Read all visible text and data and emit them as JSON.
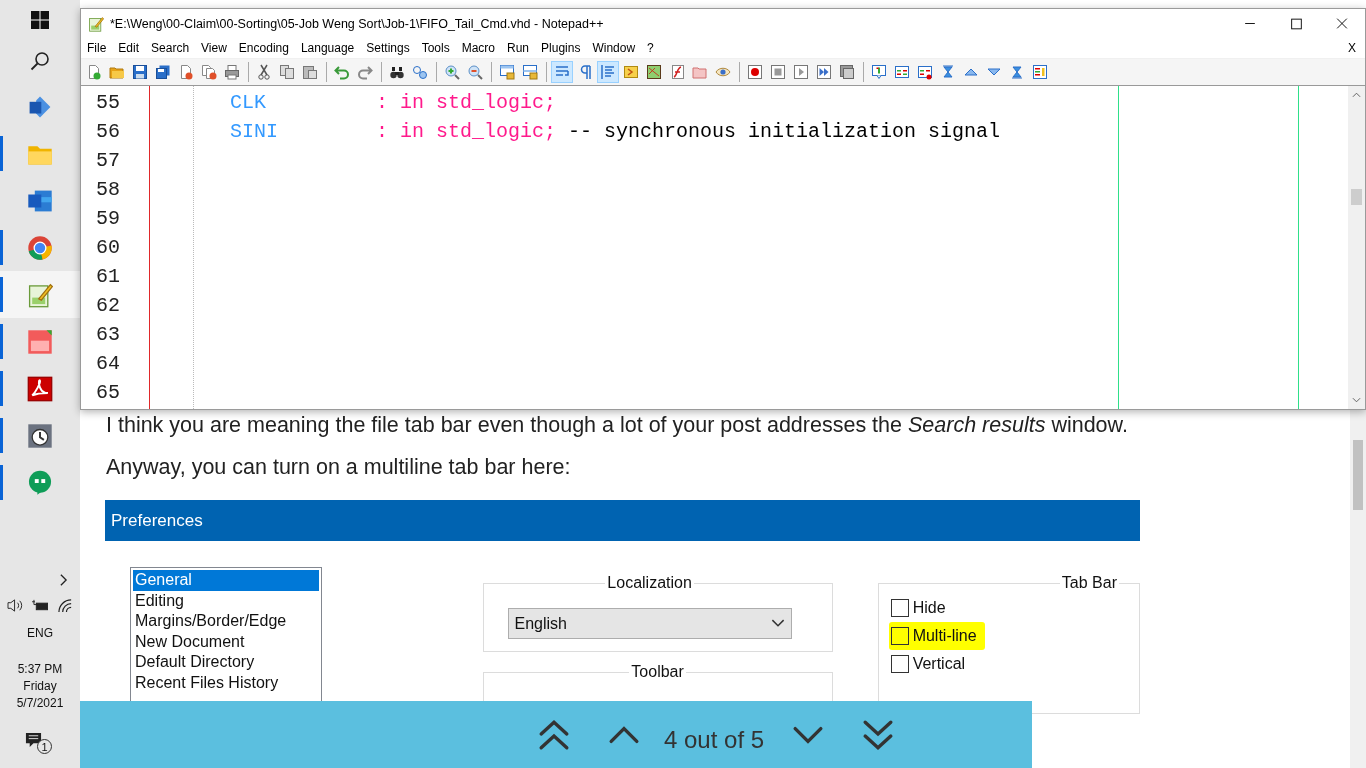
{
  "taskbar": {
    "apps": [
      {
        "kind": "visio",
        "running": false,
        "selected": false
      },
      {
        "kind": "explorer",
        "running": true,
        "selected": false
      },
      {
        "kind": "word",
        "running": false,
        "selected": false
      },
      {
        "kind": "chrome",
        "running": true,
        "selected": false
      },
      {
        "kind": "notepad",
        "running": true,
        "selected": true
      },
      {
        "kind": "pdf",
        "running": true,
        "selected": false
      },
      {
        "kind": "acrobat",
        "running": true,
        "selected": false
      },
      {
        "kind": "clock",
        "running": true,
        "selected": false
      },
      {
        "kind": "hangouts",
        "running": true,
        "selected": false
      }
    ],
    "language": "ENG",
    "time": "5:37 PM",
    "day": "Friday",
    "date": "5/7/2021",
    "notification_count": "1"
  },
  "window": {
    "title": "*E:\\Weng\\00-Claim\\00-Sorting\\05-Job Weng Sort\\Job-1\\FIFO_Tail_Cmd.vhd - Notepad++",
    "menu": [
      "File",
      "Edit",
      "Search",
      "View",
      "Encoding",
      "Language",
      "Settings",
      "Tools",
      "Macro",
      "Run",
      "Plugins",
      "Window",
      "?"
    ],
    "close_document": "X",
    "toolbar": [
      {
        "kind": "new",
        "pressed": false
      },
      {
        "kind": "open",
        "pressed": false
      },
      {
        "kind": "save",
        "pressed": false
      },
      {
        "kind": "save-all",
        "pressed": false
      },
      {
        "kind": "close",
        "pressed": false
      },
      {
        "kind": "close-all",
        "pressed": false
      },
      {
        "kind": "print",
        "pressed": false
      },
      {
        "kind": "separator"
      },
      {
        "kind": "cut",
        "pressed": false
      },
      {
        "kind": "copy",
        "pressed": false
      },
      {
        "kind": "paste",
        "pressed": false
      },
      {
        "kind": "separator"
      },
      {
        "kind": "undo",
        "pressed": false
      },
      {
        "kind": "redo",
        "pressed": false
      },
      {
        "kind": "separator"
      },
      {
        "kind": "find",
        "pressed": false
      },
      {
        "kind": "replace",
        "pressed": false
      },
      {
        "kind": "separator"
      },
      {
        "kind": "zoom-in",
        "pressed": false
      },
      {
        "kind": "zoom-out",
        "pressed": false
      },
      {
        "kind": "separator"
      },
      {
        "kind": "sync-v",
        "pressed": false
      },
      {
        "kind": "sync-h",
        "pressed": false
      },
      {
        "kind": "separator"
      },
      {
        "kind": "wrap",
        "pressed": true
      },
      {
        "kind": "all-chars",
        "pressed": false
      },
      {
        "kind": "indent",
        "pressed": true
      },
      {
        "kind": "udl",
        "pressed": false
      },
      {
        "kind": "doc-map",
        "pressed": false
      },
      {
        "kind": "func-list",
        "pressed": false
      },
      {
        "kind": "folder",
        "pressed": false
      },
      {
        "kind": "monitor",
        "pressed": false
      },
      {
        "kind": "separator"
      },
      {
        "kind": "record",
        "pressed": false
      },
      {
        "kind": "stop",
        "pressed": false
      },
      {
        "kind": "play",
        "pressed": false
      },
      {
        "kind": "play-multi",
        "pressed": false
      },
      {
        "kind": "save-macro",
        "pressed": false
      },
      {
        "kind": "separator"
      },
      {
        "kind": "bookmark",
        "pressed": false
      },
      {
        "kind": "list-a",
        "pressed": false
      },
      {
        "kind": "list-b",
        "pressed": false
      },
      {
        "kind": "top",
        "pressed": false
      },
      {
        "kind": "up",
        "pressed": false
      },
      {
        "kind": "down",
        "pressed": false
      },
      {
        "kind": "bottom",
        "pressed": false
      },
      {
        "kind": "panel",
        "pressed": false
      }
    ],
    "lines": [
      {
        "number": "55",
        "tokens": [
          {
            "kind": "name",
            "text": "CLK"
          },
          {
            "kind": "colon",
            "text": ":"
          },
          {
            "kind": "type",
            "text": "in std_logic;"
          }
        ]
      },
      {
        "number": "56",
        "tokens": [
          {
            "kind": "name",
            "text": "SINI"
          },
          {
            "kind": "colon",
            "text": ":"
          },
          {
            "kind": "type",
            "text": "in std_logic;"
          },
          {
            "kind": "comment",
            "text": "-- synchronous initialization signal"
          }
        ]
      },
      {
        "number": "57"
      },
      {
        "number": "58"
      },
      {
        "number": "59"
      },
      {
        "number": "60"
      },
      {
        "number": "61"
      },
      {
        "number": "62"
      },
      {
        "number": "63"
      },
      {
        "number": "64"
      },
      {
        "number": "65"
      }
    ]
  },
  "page": {
    "paragraphs": [
      "I think you are meaning the file tab bar even though a lot of your post addresses the *Search results* window.",
      "Anyway, you can turn on a multiline tab bar here:"
    ],
    "preferences": {
      "title": "Preferences",
      "categories": [
        {
          "label": "General",
          "selected": true
        },
        {
          "label": "Editing",
          "selected": false
        },
        {
          "label": "Margins/Border/Edge",
          "selected": false
        },
        {
          "label": "New Document",
          "selected": false
        },
        {
          "label": "Default Directory",
          "selected": false
        },
        {
          "label": "Recent Files History",
          "selected": false
        }
      ],
      "localization": {
        "label": "Localization",
        "language": "English"
      },
      "toolbar": {
        "label": "Toolbar"
      },
      "tab_bar": {
        "label": "Tab Bar",
        "options": [
          {
            "label": "Hide",
            "checked": false,
            "highlighted": false
          },
          {
            "label": "Multi-line",
            "checked": false,
            "highlighted": true
          },
          {
            "label": "Vertical",
            "checked": false,
            "highlighted": false
          }
        ]
      }
    }
  },
  "pager": {
    "position": "4 out of 5"
  }
}
